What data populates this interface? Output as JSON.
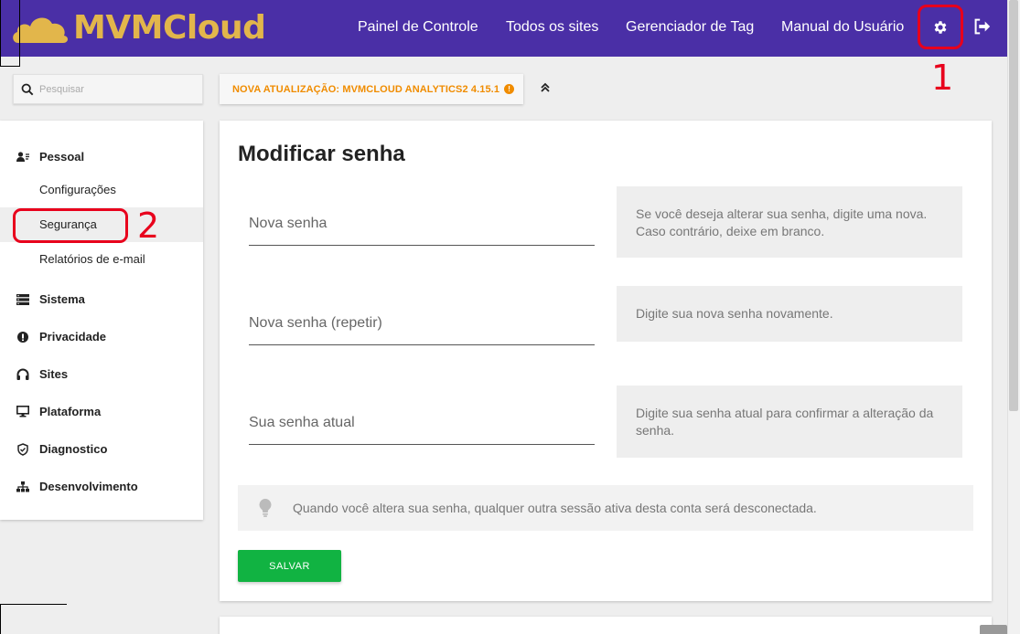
{
  "brand": {
    "name": "MVMCloud",
    "color": "#e2b64b",
    "bar_color": "#4a2fa6"
  },
  "nav": {
    "items": [
      "Painel de Controle",
      "Todos os sites",
      "Gerenciador de Tag",
      "Manual do Usuário"
    ],
    "settings_icon": "gear-icon",
    "logout_icon": "logout-icon"
  },
  "annotations": {
    "one": "1",
    "two": "2",
    "color": "#e8001c"
  },
  "search": {
    "placeholder": "Pesquisar"
  },
  "update": {
    "label": "NOVA ATUALIZAÇÃO: MVMCLOUD ANALYTICS2 4.15.1",
    "badge": "!"
  },
  "sidebar": {
    "pessoal": "Pessoal",
    "configuracoes": "Configurações",
    "seguranca": "Segurança",
    "relatorios": "Relatórios de e-mail",
    "sistema": "Sistema",
    "privacidade": "Privacidade",
    "sites": "Sites",
    "plataforma": "Plataforma",
    "diagnostico": "Diagnostico",
    "desenvolvimento": "Desenvolvimento"
  },
  "form": {
    "title": "Modificar senha",
    "new_password": {
      "placeholder": "Nova senha",
      "help": "Se você deseja alterar sua senha, digite uma nova. Caso contrário, deixe em branco."
    },
    "repeat_password": {
      "placeholder": "Nova senha (repetir)",
      "help": "Digite sua nova senha novamente."
    },
    "current_password": {
      "placeholder": "Sua senha atual",
      "help": "Digite sua senha atual para confirmar a alteração da senha."
    },
    "notice": "Quando você altera sua senha, qualquer outra sessão ativa desta conta será desconectada.",
    "save_label": "SALVAR",
    "save_color": "#11b342"
  }
}
